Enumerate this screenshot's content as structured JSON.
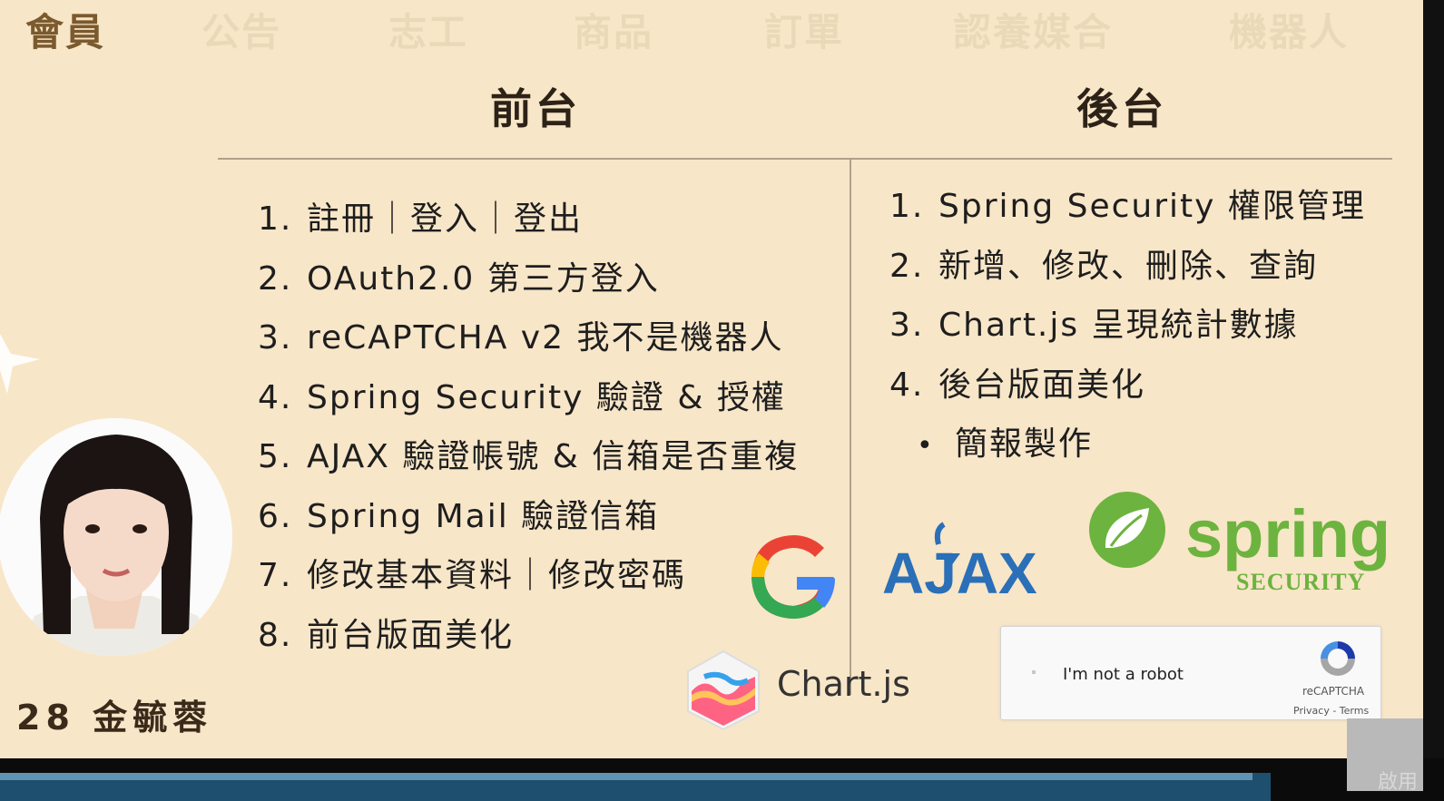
{
  "nav": {
    "items": [
      "會員",
      "公告",
      "志工",
      "商品",
      "訂單",
      "認養媒合",
      "機器人"
    ],
    "active_index": 0
  },
  "frontend": {
    "title": "前台",
    "items": [
      {
        "num": "1.",
        "text": "註冊｜登入｜登出"
      },
      {
        "num": "2.",
        "text": "OAuth2.0 第三方登入"
      },
      {
        "num": "3.",
        "text": "reCAPTCHA v2 我不是機器人"
      },
      {
        "num": "4.",
        "text": "Spring Security 驗證 & 授權"
      },
      {
        "num": "5.",
        "text": "AJAX 驗證帳號 & 信箱是否重複"
      },
      {
        "num": "6.",
        "text": "Spring Mail 驗證信箱"
      },
      {
        "num": "7.",
        "text": "修改基本資料｜修改密碼"
      },
      {
        "num": "8.",
        "text": "前台版面美化"
      }
    ]
  },
  "backend": {
    "title": "後台",
    "items": [
      {
        "num": "1.",
        "text": "Spring Security 權限管理"
      },
      {
        "num": "2.",
        "text": "新增、修改、刪除、查詢"
      },
      {
        "num": "3.",
        "text": "Chart.js 呈現統計數據"
      },
      {
        "num": "4.",
        "text": "後台版面美化"
      }
    ],
    "bullet": {
      "mark": "•",
      "text": "簡報製作"
    }
  },
  "presenter": {
    "name": "28 金毓蓉"
  },
  "logos": {
    "chartjs": "Chart.js",
    "ajax": "AJAX",
    "spring": "spring",
    "spring_sub": "SECURITY"
  },
  "recaptcha": {
    "label": "I'm not a robot",
    "brand": "reCAPTCHA",
    "links": "Privacy - Terms"
  },
  "corner": {
    "text": "啟用"
  },
  "colors": {
    "background": "#f8e6c8",
    "nav_active": "#7a5a2e",
    "nav_inactive": "#ead9b9",
    "spring_green": "#6db33f",
    "ajax_blue": "#2a6fb8"
  }
}
